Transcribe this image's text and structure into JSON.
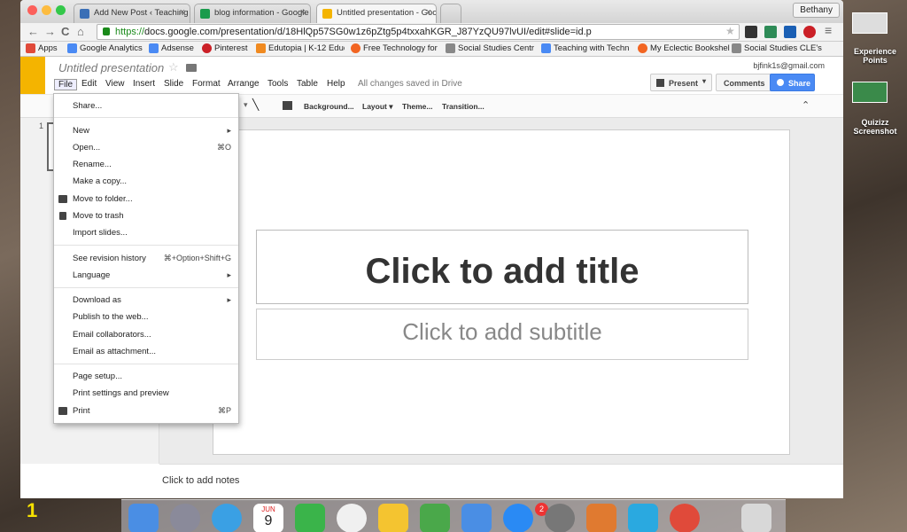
{
  "window": {
    "tabs": [
      {
        "label": "Add New Post ‹ Teaching w",
        "color": "#3b6fb6"
      },
      {
        "label": "blog information - Google D",
        "color": "#1a9b4c"
      },
      {
        "label": "Untitled presentation - Goo",
        "color": "#f4b400"
      }
    ],
    "user": "Bethany",
    "url_scheme": "https://",
    "url_rest": "docs.google.com/presentation/d/18HlQp57SG0w1z6pZtg5p4txxahKGR_J87YzQU97lvUI/edit#slide=id.p"
  },
  "bookmarks": [
    {
      "label": "Apps",
      "color": "#e04a3a"
    },
    {
      "label": "Google Analytics",
      "color": "#4a8af4"
    },
    {
      "label": "Adsense",
      "color": "#4a8af4"
    },
    {
      "label": "Pinterest",
      "color": "#cb2027"
    },
    {
      "label": "Edutopia | K-12 Educ",
      "color": "#f08a20"
    },
    {
      "label": "Free Technology for",
      "color": "#f26522"
    },
    {
      "label": "Social Studies Centr",
      "color": "#888888"
    },
    {
      "label": "Teaching with Techn",
      "color": "#4a8af4"
    },
    {
      "label": "My Eclectic Bookshel",
      "color": "#f26522"
    },
    {
      "label": "Social Studies CLE's",
      "color": "#888888"
    }
  ],
  "app": {
    "title": "Untitled presentation",
    "menus": [
      "File",
      "Edit",
      "View",
      "Insert",
      "Slide",
      "Format",
      "Arrange",
      "Tools",
      "Table",
      "Help"
    ],
    "saved": "All changes saved in Drive",
    "account": "bjfink1s@gmail.com",
    "present": "Present",
    "comments": "Comments",
    "share": "Share"
  },
  "toolbar": {
    "background": "Background...",
    "layout": "Layout",
    "theme": "Theme...",
    "transition": "Transition..."
  },
  "slide": {
    "number": "1",
    "title": "Click to add title",
    "subtitle": "Click to add subtitle"
  },
  "notes": "Click to add notes",
  "file_menu": {
    "share": "Share...",
    "new": "New",
    "open": "Open...",
    "open_sc": "⌘O",
    "rename": "Rename...",
    "copy": "Make a copy...",
    "move": "Move to folder...",
    "trash": "Move to trash",
    "import": "Import slides...",
    "revision": "See revision history",
    "revision_sc": "⌘+Option+Shift+G",
    "language": "Language",
    "download": "Download as",
    "publish": "Publish to the web...",
    "email_collab": "Email collaborators...",
    "email_attach": "Email as attachment...",
    "page_setup": "Page setup...",
    "print_settings": "Print settings and preview",
    "print": "Print",
    "print_sc": "⌘P"
  },
  "desktop": {
    "item1": "Experience Points",
    "item2": "Quizizz Screenshot",
    "corner_number": "1",
    "calendar_month": "JUN",
    "calendar_day": "9",
    "badge": "2"
  }
}
